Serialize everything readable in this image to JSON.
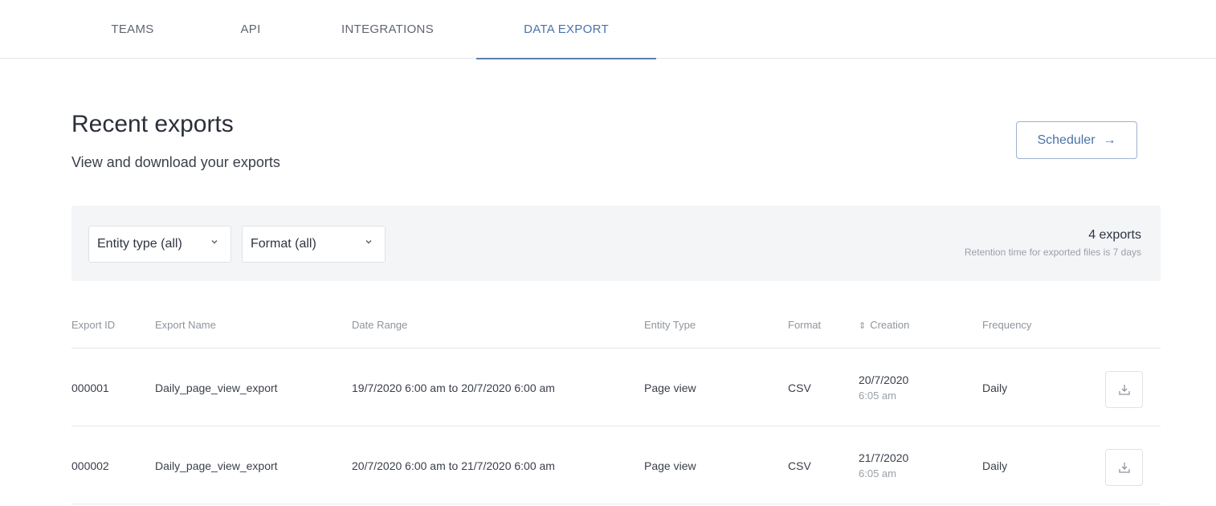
{
  "tabs": [
    {
      "label": "TEAMS"
    },
    {
      "label": "API"
    },
    {
      "label": "INTEGRATIONS"
    },
    {
      "label": "DATA EXPORT",
      "active": true
    }
  ],
  "header": {
    "title": "Recent exports",
    "subtitle": "View and download your exports",
    "scheduler_label": "Scheduler",
    "scheduler_icon": "arrow-right-icon"
  },
  "filters": {
    "entity_type": "Entity type (all)",
    "format": "Format (all)",
    "count": "4 exports",
    "retention": "Retention time for exported files is 7 days"
  },
  "table": {
    "columns": {
      "id": "Export ID",
      "name": "Export Name",
      "range": "Date Range",
      "entity": "Entity Type",
      "format": "Format",
      "creation": "Creation",
      "frequency": "Frequency"
    },
    "rows": [
      {
        "id": "000001",
        "name": "Daily_page_view_export",
        "range": "19/7/2020 6:00 am to 20/7/2020 6:00 am",
        "entity": "Page view",
        "format": "CSV",
        "creation_date": "20/7/2020",
        "creation_time": "6:05 am",
        "frequency": "Daily"
      },
      {
        "id": "000002",
        "name": "Daily_page_view_export",
        "range": "20/7/2020 6:00 am to 21/7/2020 6:00 am",
        "entity": "Page view",
        "format": "CSV",
        "creation_date": "21/7/2020",
        "creation_time": "6:05 am",
        "frequency": "Daily"
      }
    ]
  },
  "colors": {
    "accent": "#4a73a8",
    "border": "#e3e6ea",
    "filter_bg": "#f4f5f7"
  }
}
